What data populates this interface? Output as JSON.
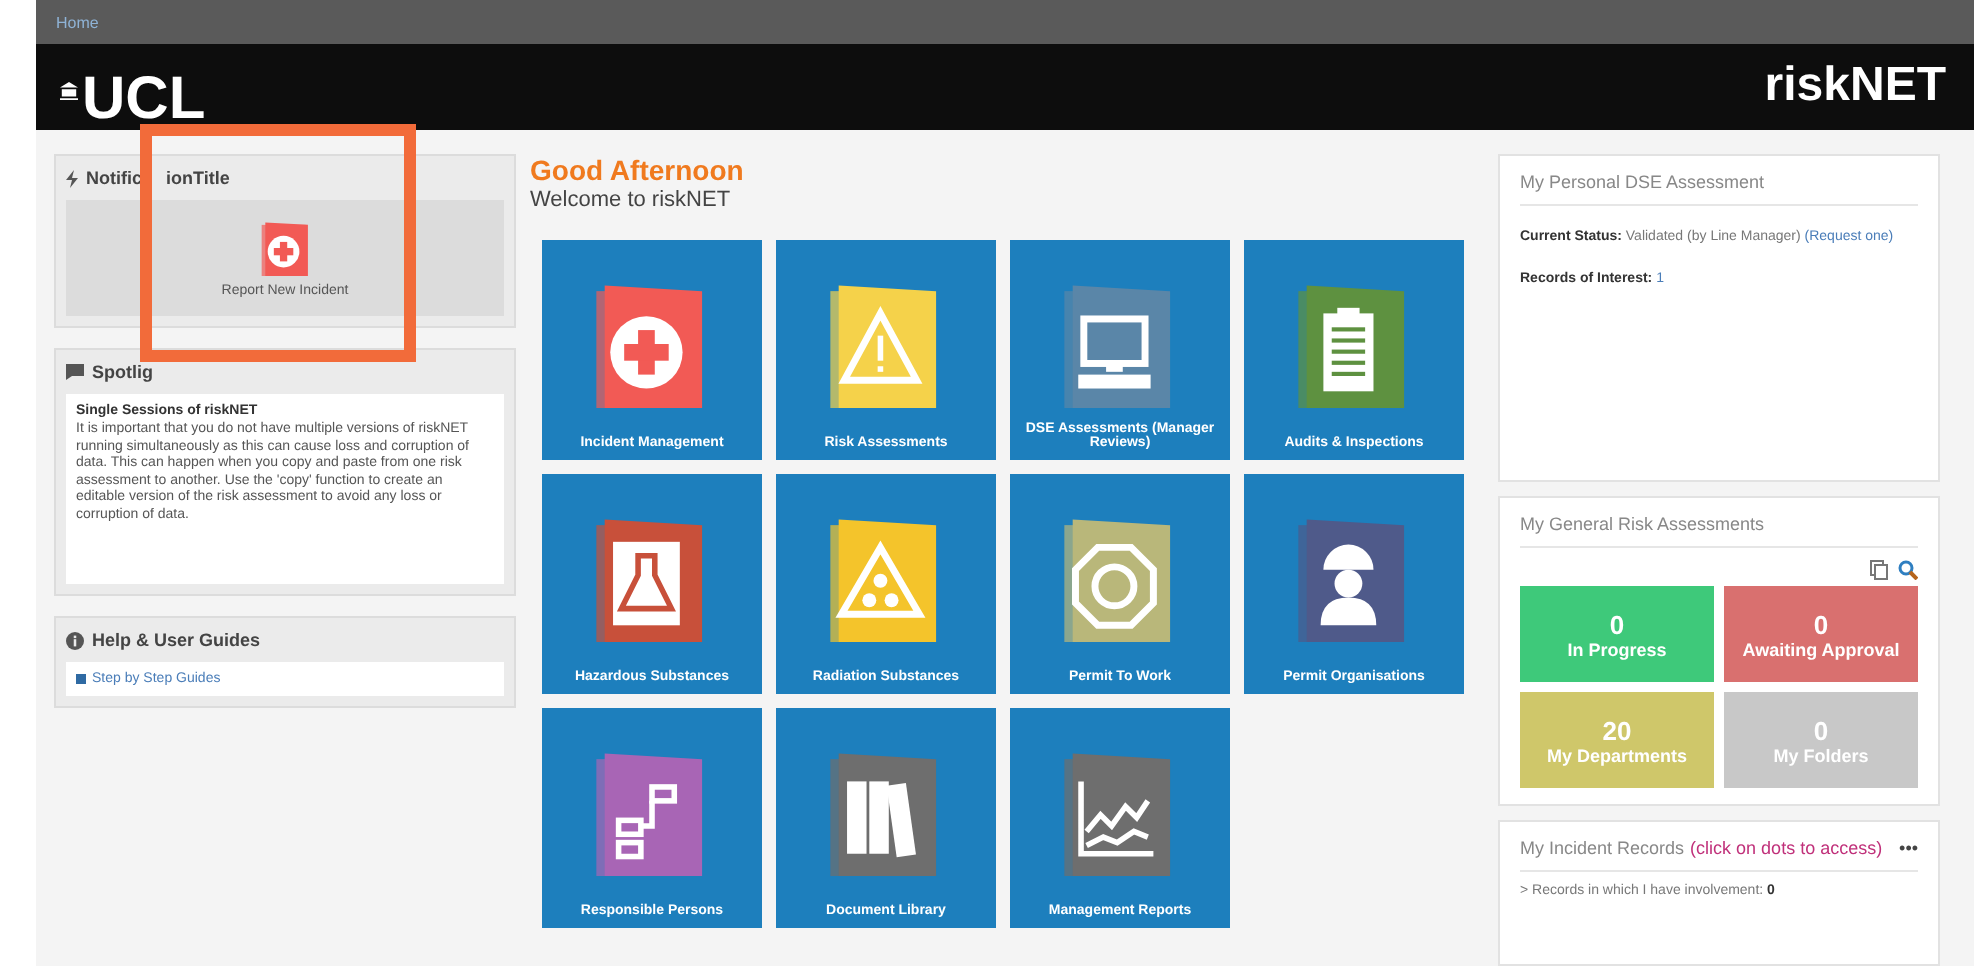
{
  "breadcrumb": "Home",
  "header": {
    "logo": "UCL",
    "app_name": "riskNET"
  },
  "notification_panel": {
    "title_parts": [
      "Notific",
      "ionTitle"
    ],
    "action": "Report New Incident"
  },
  "spotlight_panel": {
    "title": "Spotlig",
    "heading": "Single Sessions of riskNET",
    "body": "It is important that you do not have multiple versions of riskNET running simultaneously as this can cause loss and corruption of data. This can happen when you copy and paste from one risk assessment to another. Use the 'copy' function to create an editable version of the risk assessment to avoid any loss or corruption of data."
  },
  "help_panel": {
    "title": "Help & User Guides",
    "links": [
      "Step by Step Guides"
    ]
  },
  "greeting": "Good Afternoon",
  "welcome": "Welcome to riskNET",
  "tiles": [
    {
      "label": "Incident Management"
    },
    {
      "label": "Risk Assessments"
    },
    {
      "label": "DSE Assessments (Manager Reviews)"
    },
    {
      "label": "Audits & Inspections"
    },
    {
      "label": "Hazardous Substances"
    },
    {
      "label": "Radiation Substances"
    },
    {
      "label": "Permit To Work"
    },
    {
      "label": "Permit Organisations"
    },
    {
      "label": "Responsible Persons"
    },
    {
      "label": "Document Library"
    },
    {
      "label": "Management Reports"
    }
  ],
  "dse_panel": {
    "title": "My Personal DSE Assessment",
    "status_label": "Current Status:",
    "status_value": "Validated (by Line Manager)",
    "status_link": "(Request one)",
    "records_label": "Records of Interest:",
    "records_value": "1"
  },
  "risk_panel": {
    "title": "My General Risk Assessments",
    "stats": [
      {
        "count": "0",
        "label": "In Progress",
        "color": "#3ec97a"
      },
      {
        "count": "0",
        "label": "Awaiting Approval",
        "color": "#d9706f"
      },
      {
        "count": "20",
        "label": "My Departments",
        "color": "#cfc76a"
      },
      {
        "count": "0",
        "label": "My Folders",
        "color": "#c8c8c8"
      }
    ]
  },
  "incident_panel": {
    "title": "My Incident Records",
    "hint": "(click on dots to access)",
    "more": "•••",
    "line": "> Records in which I have involvement:",
    "count": "0"
  }
}
